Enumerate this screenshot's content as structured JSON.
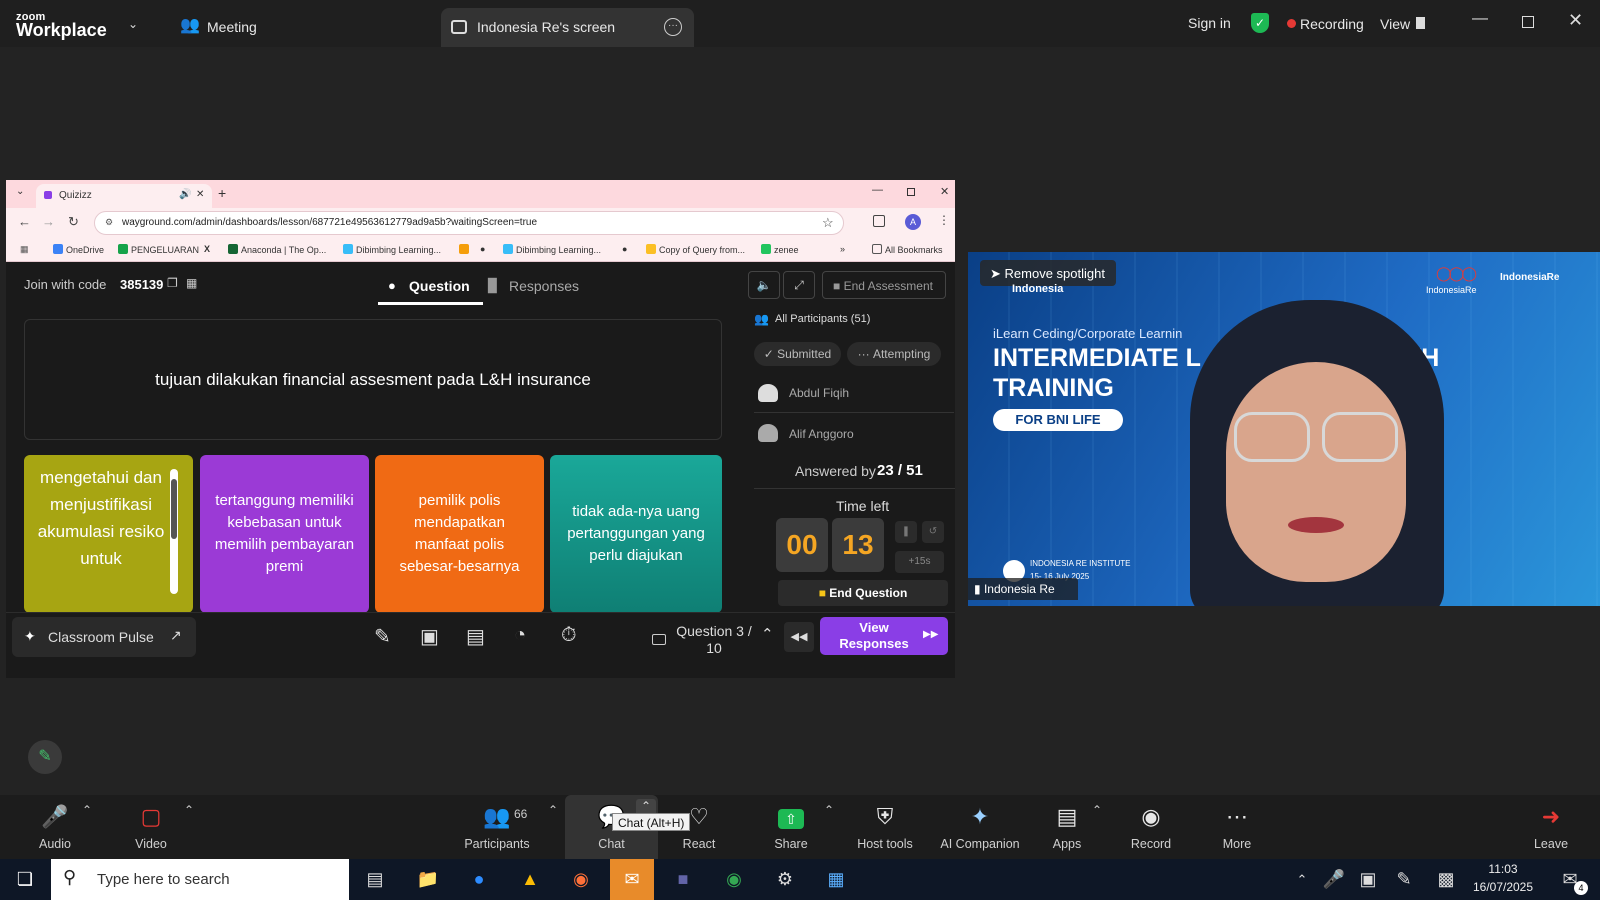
{
  "app": {
    "logo_small": "zoom",
    "logo_big": "Workplace",
    "meeting_label": "Meeting",
    "tab_label": "Indonesia Re's screen",
    "sign_in": "Sign in",
    "recording": "Recording",
    "view": "View"
  },
  "browser": {
    "tab_title": "Quizizz",
    "url": "wayground.com/admin/dashboards/lesson/687721e49563612779ad9a5b?waitingScreen=true",
    "avatar_letter": "A",
    "bookmarks": [
      "OneDrive",
      "PENGELUARAN",
      "Anaconda | The Op...",
      "Dibimbing Learning...",
      "Dibimbing Learning...",
      "Copy of Query from...",
      "zenee"
    ],
    "all_bookmarks": "All Bookmarks"
  },
  "quiz": {
    "join_label": "Join with code",
    "join_code": "385139",
    "tab_question": "Question",
    "tab_responses": "Responses",
    "end_assessment": "End Assessment",
    "question": "tujuan dilakukan financial assesment pada L&H insurance",
    "options": [
      "mengetahui dan menjustifikasi akumulasi resiko untuk",
      "tertanggung memiliki kebebasan untuk memilih pembayaran premi",
      "pemilik polis mendapatkan manfaat polis sebesar-besarnya",
      "tidak ada-nya uang pertanggungan yang perlu diajukan"
    ],
    "all_participants": "All Participants (51)",
    "filter_submitted": "Submitted",
    "filter_attempting": "Attempting",
    "participants": [
      "Abdul Fiqih",
      "Alif Anggoro"
    ],
    "answered_label": "Answered by",
    "answered_value": "23 / 51",
    "time_left_label": "Time left",
    "time_min": "00",
    "time_sec": "13",
    "plus15": "+15s",
    "end_question": "End Question",
    "classroom_pulse": "Classroom Pulse",
    "question_counter": "Question 3 / 10",
    "view_responses": "View Responses"
  },
  "video": {
    "remove_spotlight": "Remove spotlight",
    "line1": "Indonesia",
    "line2": "iLearn Ceding/Corporate Learnin",
    "title1": "INTERMEDIATE L",
    "title1b": "TH",
    "title2": "TRAINING",
    "badge": "FOR BNI LIFE",
    "logo1": "IndonesiaRe",
    "logo2": "IndonesiaRe",
    "inst": "INDONESIA RE INSTITUTE",
    "dates": "15- 16 July 2025",
    "name": "Indonesia Re"
  },
  "toolbar": {
    "audio": "Audio",
    "video": "Video",
    "participants": "Participants",
    "participants_count": "66",
    "chat": "Chat",
    "chat_tooltip": "Chat (Alt+H)",
    "react": "React",
    "share": "Share",
    "host_tools": "Host tools",
    "ai": "AI Companion",
    "apps": "Apps",
    "record": "Record",
    "more": "More",
    "leave": "Leave"
  },
  "taskbar": {
    "search_placeholder": "Type here to search",
    "time": "11:03",
    "date": "16/07/2025",
    "notif": "4"
  },
  "colors": {
    "opt1": "#a7a512",
    "opt2": "#9b3ad6",
    "opt3": "#f06a14",
    "opt4": "#1aa899",
    "purple": "#8a3ee6"
  }
}
